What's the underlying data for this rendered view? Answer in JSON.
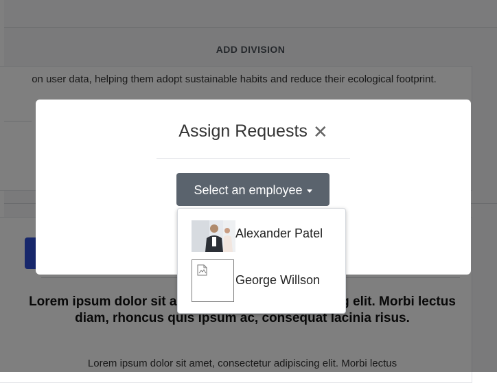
{
  "page": {
    "section_title": "ADD DIVISION",
    "card_text": "on user data, helping them adopt sustainable habits and reduce their ecological footprint.",
    "heading": "Lorem ipsum dolor sit amet, consectetur adipiscing elit. Morbi lectus diam, rhoncus quis ipsum ac, consequat lacinia risus.",
    "body": "Lorem ipsum dolor sit amet, consectetur adipiscing elit. Morbi lectus"
  },
  "modal": {
    "title": "Assign Requests",
    "close_icon": "close-icon",
    "select_label": "Select an employee"
  },
  "dropdown": {
    "items": [
      {
        "name": "Alexander Patel",
        "avatar": "photo"
      },
      {
        "name": "George Willson",
        "avatar": "broken-image-icon"
      }
    ]
  },
  "colors": {
    "overlay": "#000000",
    "select_button": "#5a636d",
    "accent_blue": "#2f4fd6"
  }
}
